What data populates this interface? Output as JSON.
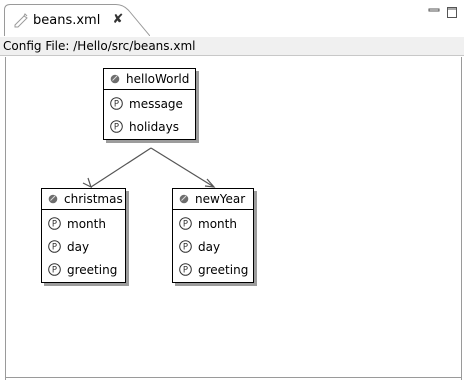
{
  "tab": {
    "label": "beans.xml",
    "close_glyph": "✘",
    "file_icon": "file-icon",
    "close_icon": "close-icon"
  },
  "window_controls": {
    "minimize_icon": "minimize-icon",
    "maximize_icon": "maximize-icon"
  },
  "config": {
    "text": "Config File: /Hello/src/beans.xml"
  },
  "beans": {
    "helloWorld": {
      "title": "helloWorld",
      "properties": [
        "message",
        "holidays"
      ]
    },
    "christmas": {
      "title": "christmas",
      "properties": [
        "month",
        "day",
        "greeting"
      ]
    },
    "newYear": {
      "title": "newYear",
      "properties": [
        "month",
        "day",
        "greeting"
      ]
    }
  },
  "icons": {
    "bean": "bean-icon",
    "property": "property-icon",
    "property_glyph": "P"
  },
  "colors": {
    "shadow": "#9c9c9c",
    "connector": "#555555",
    "header_bar": "#f0f0f0"
  }
}
